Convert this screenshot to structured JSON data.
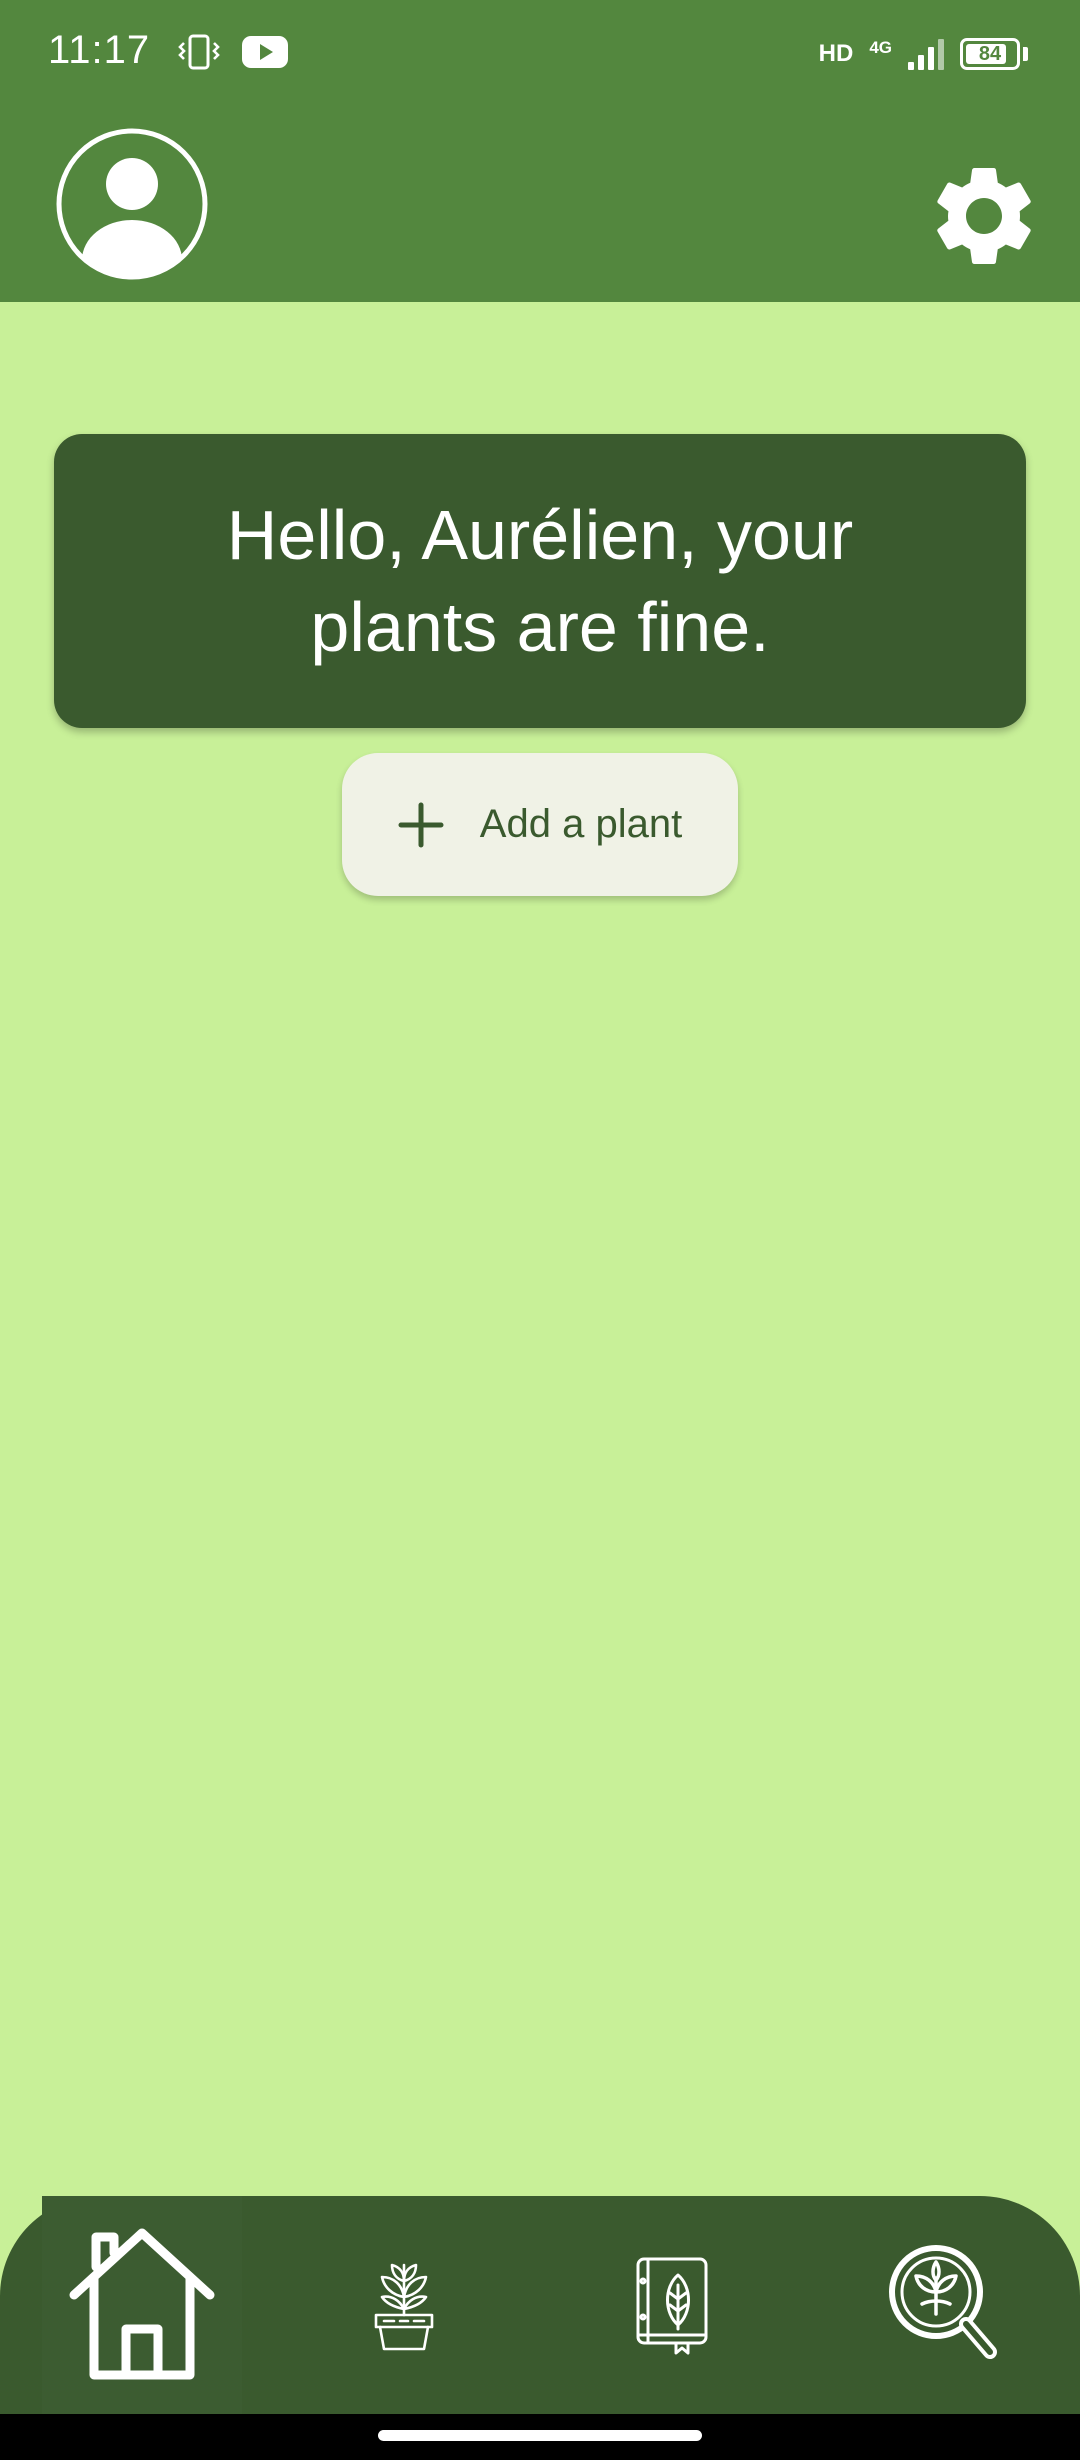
{
  "status_bar": {
    "time": "11:17",
    "left_icons": [
      "vibrate-icon",
      "youtube-icon"
    ],
    "hd_label": "HD",
    "network_label": "4G",
    "battery_level": "84",
    "battery_fraction": 0.84
  },
  "app_bar": {
    "profile_icon": "account-circle-icon",
    "settings_icon": "gear-icon"
  },
  "greeting": {
    "text": "Hello, Aurélien, your plants are fine."
  },
  "add_plant": {
    "icon": "plus-icon",
    "label": "Add a plant"
  },
  "bottom_nav": {
    "items": [
      {
        "icon": "home-icon",
        "selected": true
      },
      {
        "icon": "potted-plant-icon",
        "selected": false
      },
      {
        "icon": "leaf-book-icon",
        "selected": false
      },
      {
        "icon": "plant-search-icon",
        "selected": false
      }
    ]
  },
  "colors": {
    "header": "#53873e",
    "background": "#c8f098",
    "card": "#3a5a2e",
    "button": "#f0f2e6",
    "accent_text": "#3a5a2e"
  }
}
